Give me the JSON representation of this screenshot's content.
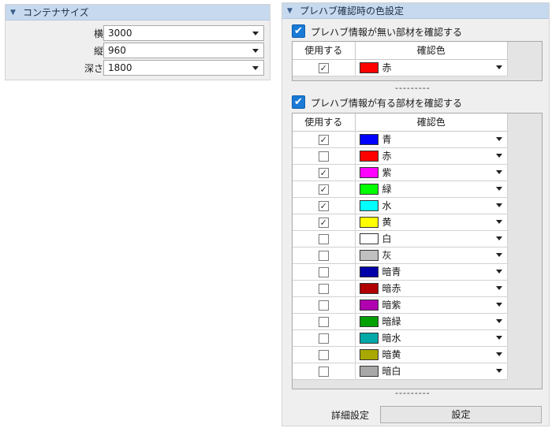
{
  "left_panel": {
    "title": "コンテナサイズ",
    "fields": [
      {
        "label": "横",
        "value": "3000"
      },
      {
        "label": "縦",
        "value": "960"
      },
      {
        "label": "深さ",
        "value": "1800"
      }
    ]
  },
  "right_panel": {
    "title": "プレハブ確認時の色設定",
    "section1": {
      "checked": true,
      "label": "プレハブ情報が無い部材を確認する",
      "headers": {
        "use": "使用する",
        "color": "確認色"
      },
      "rows": [
        {
          "use": true,
          "color": "#ff0000",
          "name": "赤"
        }
      ]
    },
    "separator": "---------",
    "section2": {
      "checked": true,
      "label": "プレハブ情報が有る部材を確認する",
      "headers": {
        "use": "使用する",
        "color": "確認色"
      },
      "rows": [
        {
          "use": true,
          "color": "#0000ff",
          "name": "青"
        },
        {
          "use": false,
          "color": "#ff0000",
          "name": "赤"
        },
        {
          "use": true,
          "color": "#ff00ff",
          "name": "紫"
        },
        {
          "use": true,
          "color": "#00ff00",
          "name": "緑"
        },
        {
          "use": true,
          "color": "#00ffff",
          "name": "水"
        },
        {
          "use": true,
          "color": "#ffff00",
          "name": "黄"
        },
        {
          "use": false,
          "color": "#ffffff",
          "name": "白"
        },
        {
          "use": false,
          "color": "#c0c0c0",
          "name": "灰"
        },
        {
          "use": false,
          "color": "#0000a8",
          "name": "暗青"
        },
        {
          "use": false,
          "color": "#b00000",
          "name": "暗赤"
        },
        {
          "use": false,
          "color": "#b000b0",
          "name": "暗紫"
        },
        {
          "use": false,
          "color": "#00a000",
          "name": "暗緑"
        },
        {
          "use": false,
          "color": "#00a8a8",
          "name": "暗水"
        },
        {
          "use": false,
          "color": "#a8a800",
          "name": "暗黄"
        },
        {
          "use": false,
          "color": "#a8a8a8",
          "name": "暗白"
        }
      ]
    },
    "separator2": "---------",
    "detail": {
      "label": "詳細設定",
      "button": "設定"
    }
  }
}
